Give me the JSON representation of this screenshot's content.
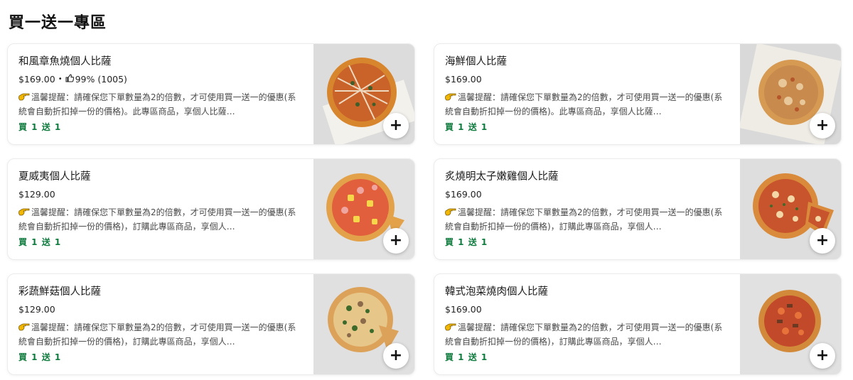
{
  "section": {
    "title": "買一送一專區"
  },
  "items": [
    {
      "name": "和風章魚燒個人比薩",
      "price": "$169.00",
      "rating": "99% (1005)",
      "desc": "溫馨提醒：請確保您下單數量為2的倍數，才可使用買一送一的優惠(系統會自動折扣掉一份的價格)。此專區商品，享個人比薩…",
      "promo": "買 1 送 1",
      "add_label": "+"
    },
    {
      "name": "海鮮個人比薩",
      "price": "$169.00",
      "desc": "溫馨提醒：請確保您下單數量為2的倍數，才可使用買一送一的優惠(系統會自動折扣掉一份的價格)。此專區商品，享個人比薩…",
      "promo": "買 1 送 1",
      "add_label": "+"
    },
    {
      "name": "夏威夷個人比薩",
      "price": "$129.00",
      "desc": "溫馨提醒：請確保您下單數量為2的倍數，才可使用買一送一的優惠(系統會自動折扣掉一份的價格)，訂購此專區商品，享個人…",
      "promo": "買 1 送 1",
      "add_label": "+"
    },
    {
      "name": "炙燒明太子嫩雞個人比薩",
      "price": "$169.00",
      "desc": "溫馨提醒：請確保您下單數量為2的倍數，才可使用買一送一的優惠(系統會自動折扣掉一份的價格)，訂購此專區商品，享個人…",
      "promo": "買 1 送 1",
      "add_label": "+"
    },
    {
      "name": "彩蔬鮮菇個人比薩",
      "price": "$129.00",
      "desc": "溫馨提醒：請確保您下單數量為2的倍數，才可使用買一送一的優惠(系統會自動折扣掉一份的價格)，訂購此專區商品，享個人…",
      "promo": "買 1 送 1",
      "add_label": "+"
    },
    {
      "name": "韓式泡菜燒肉個人比薩",
      "price": "$169.00",
      "desc": "溫馨提醒：請確保您下單數量為2的倍數，才可使用買一送一的優惠(系統會自動折扣掉一份的價格)，訂購此專區商品，享個人…",
      "promo": "買 1 送 1",
      "add_label": "+"
    }
  ],
  "colors": {
    "promo": "#0f7b3e",
    "hand": "#f2b705"
  },
  "icons": {
    "thumb": "thumbs-up-icon",
    "hand": "pointing-hand-icon",
    "add": "plus-icon"
  }
}
